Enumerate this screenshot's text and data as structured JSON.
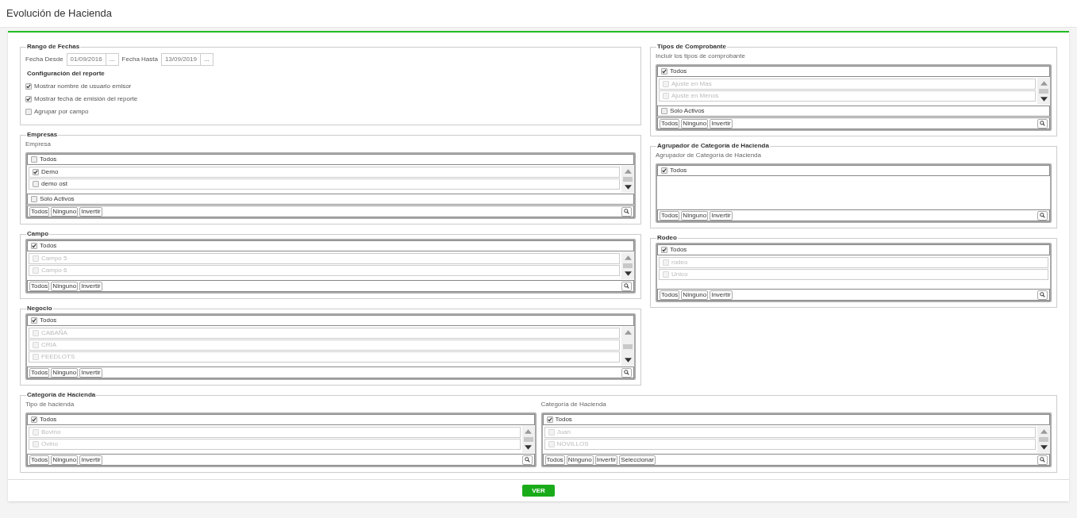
{
  "page_title": "Evolución de Hacienda",
  "left": [
    {
      "kind": "dates",
      "legend": "Rango de Fechas",
      "fields": [
        {
          "label": "Fecha Desde",
          "value": "01/09/2016",
          "button": "..."
        },
        {
          "label": "Fecha Hasta",
          "value": "13/09/2019",
          "button": "..."
        }
      ],
      "config_title": "Configuración del reporte",
      "options": [
        {
          "label": "Mostrar nombre de usuario emisor",
          "checked": true
        },
        {
          "label": "Mostrar fecha de emisión del reporte",
          "checked": true
        },
        {
          "label": "Agrupar por campo",
          "checked": false
        }
      ]
    },
    {
      "kind": "list",
      "legend": "Empresas",
      "lists": [
        {
          "label": "Empresa",
          "kind": "scroll",
          "all": {
            "label": "Todos",
            "checked": false
          },
          "items": [
            {
              "label": "Demo",
              "checked": true,
              "disabled": false
            },
            {
              "label": "demo ost",
              "checked": false,
              "disabled": false
            }
          ],
          "solo_activos": {
            "label": "Solo Activos",
            "checked": false
          },
          "buttons": [
            "Todos",
            "Ninguno",
            "Invertir"
          ]
        }
      ]
    },
    {
      "kind": "list",
      "legend": "Campo",
      "lists": [
        {
          "kind": "scroll",
          "all": {
            "label": "Todos",
            "checked": true
          },
          "items": [
            {
              "label": "Campo 5",
              "checked": false,
              "disabled": true
            },
            {
              "label": "Campo 6",
              "checked": false,
              "disabled": true
            }
          ],
          "buttons": [
            "Todos",
            "Ninguno",
            "Invertir"
          ]
        }
      ]
    },
    {
      "kind": "list",
      "legend": "Negocio",
      "lists": [
        {
          "kind": "scroll",
          "all": {
            "label": "Todos",
            "checked": true
          },
          "items": [
            {
              "label": "CABAÑA",
              "checked": false,
              "disabled": true
            },
            {
              "label": "CRIA",
              "checked": false,
              "disabled": true
            },
            {
              "label": "FEEDLOTS",
              "checked": false,
              "disabled": true
            }
          ],
          "buttons": [
            "Todos",
            "Ninguno",
            "Invertir"
          ]
        }
      ]
    }
  ],
  "right": [
    {
      "kind": "list",
      "legend": "Tipos de Comprobante",
      "lists": [
        {
          "label": "Incluir los tipos de comprobante",
          "kind": "scroll",
          "all": {
            "label": "Todos",
            "checked": true
          },
          "items": [
            {
              "label": "Ajuste en Mas",
              "checked": false,
              "disabled": true
            },
            {
              "label": "Ajuste en Menos",
              "checked": false,
              "disabled": true
            }
          ],
          "solo_activos": {
            "label": "Solo Activos",
            "checked": false
          },
          "buttons": [
            "Todos",
            "Ninguno",
            "Invertir"
          ]
        }
      ]
    },
    {
      "kind": "list",
      "legend": "Agrupador de Categoría de Hacienda",
      "lists": [
        {
          "label": "Agrupador de Categoría de Hacienda",
          "kind": "fixed",
          "all": {
            "label": "Todos",
            "checked": true
          },
          "buttons": [
            "Todos",
            "Ninguno",
            "Invertir"
          ]
        }
      ]
    },
    {
      "kind": "list",
      "legend": "Rodeo",
      "lists": [
        {
          "kind": "fixed",
          "all": {
            "label": "Todos",
            "checked": true
          },
          "items": [
            {
              "label": "rodeo",
              "checked": false,
              "disabled": true
            },
            {
              "label": "Unico",
              "checked": false,
              "disabled": true
            }
          ],
          "buttons": [
            "Todos",
            "Ninguno",
            "Invertir"
          ]
        }
      ]
    }
  ],
  "bottom": {
    "kind": "list",
    "legend": "Categoría de Hacienda",
    "lists": [
      {
        "label": "Tipo de hacienda",
        "kind": "scroll",
        "all": {
          "label": "Todos",
          "checked": true
        },
        "items": [
          {
            "label": "Bovino",
            "checked": false,
            "disabled": true
          },
          {
            "label": "Ovino",
            "checked": false,
            "disabled": true
          }
        ],
        "buttons": [
          "Todos",
          "Ninguno",
          "Invertir"
        ]
      },
      {
        "label": "Categoría de Hacienda",
        "kind": "scroll",
        "all": {
          "label": "Todos",
          "checked": true
        },
        "items": [
          {
            "label": "Juan",
            "checked": false,
            "disabled": true
          },
          {
            "label": "NOVILLOS",
            "checked": false,
            "disabled": true
          }
        ],
        "buttons": [
          "Todos",
          "Ninguno",
          "Invertir",
          "Seleccionar"
        ]
      }
    ]
  },
  "submit": "VER"
}
